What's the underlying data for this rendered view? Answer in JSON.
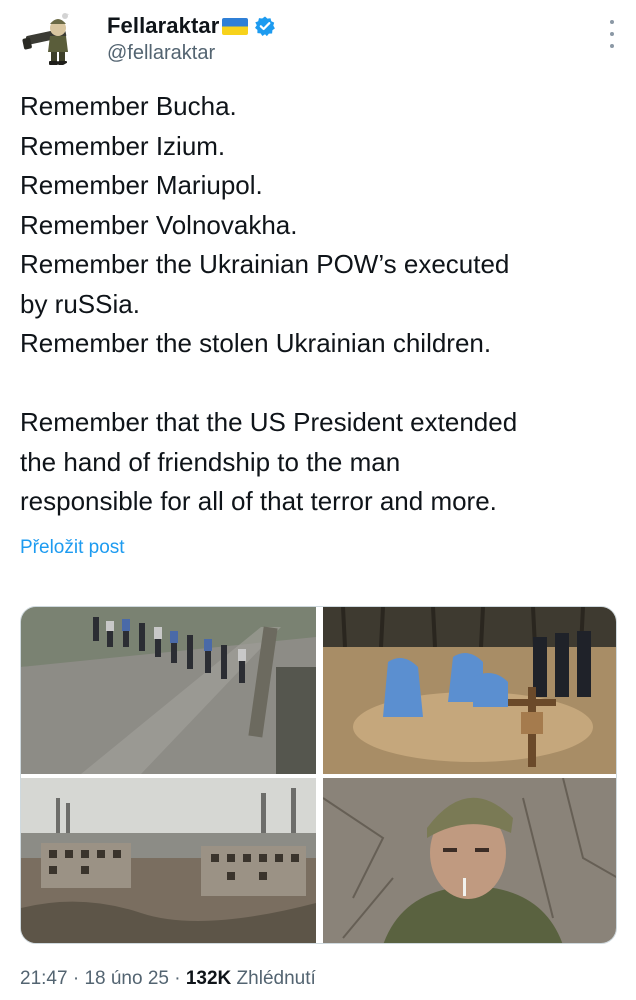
{
  "author": {
    "display_name": "Fellaraktar",
    "handle": "@fellaraktar",
    "flag_icon": "ukraine-flag-icon",
    "verified_icon": "verified-badge-icon",
    "verified_color": "#1d9bf0"
  },
  "tweet": {
    "lines": [
      "Remember Bucha.",
      "Remember Izium.",
      "Remember Mariupol.",
      "Remember Volnovakha.",
      "Remember the Ukrainian POW’s executed",
      "by ruSSia.",
      "Remember the stolen Ukrainian children.",
      "",
      "Remember that the US President extended",
      "the hand of friendship to the man",
      "responsible for all of that terror and more."
    ],
    "translate_label": "Přeložit post"
  },
  "media": {
    "count": 4
  },
  "footer": {
    "time": "21:47",
    "separator": " · ",
    "date": "18 úno 25",
    "views_count": "132K",
    "views_label": " Zhlédnutí"
  },
  "colors": {
    "link": "#1d9bf0",
    "secondary_text": "#536471",
    "primary_text": "#0f1419"
  }
}
